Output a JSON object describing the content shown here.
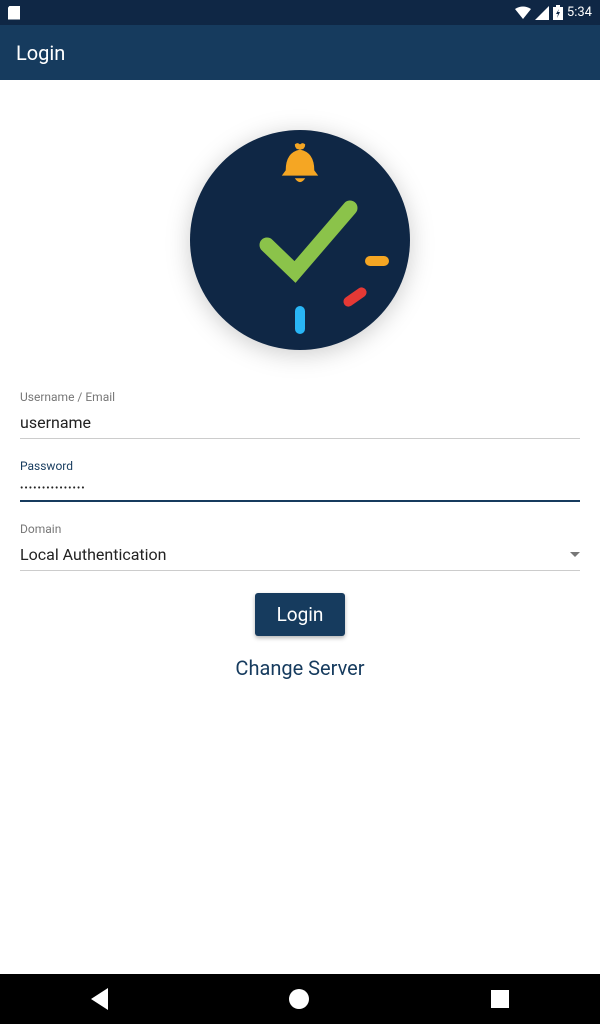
{
  "status_bar": {
    "time": "5:34"
  },
  "app_bar": {
    "title": "Login"
  },
  "form": {
    "username": {
      "label": "Username / Email",
      "value": "username"
    },
    "password": {
      "label": "Password",
      "value": "•••••••••••••••"
    },
    "domain": {
      "label": "Domain",
      "value": "Local Authentication"
    },
    "login_button": "Login",
    "change_server": "Change Server"
  }
}
